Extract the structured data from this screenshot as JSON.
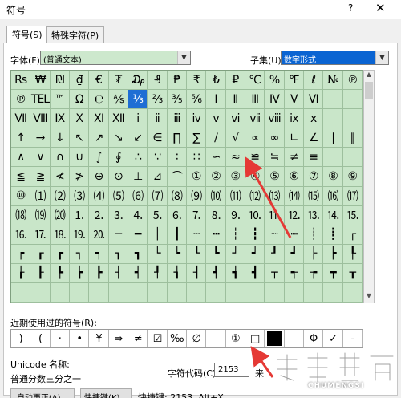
{
  "window": {
    "title": "符号",
    "help": "?",
    "close": "✕"
  },
  "tabs": [
    "符号(S)",
    "特殊字符(P)"
  ],
  "font": {
    "label": "字体(F):",
    "value": "(普通文本)"
  },
  "subset": {
    "label": "子集(U):",
    "value": "数字形式"
  },
  "grid": [
    [
      "Rs",
      "₩",
      "₪",
      "₫",
      "€",
      "₮",
      "₯",
      "₰",
      "₱",
      "₹",
      "₺",
      "₽",
      "℃",
      "%",
      "℉",
      "ℓ",
      "№",
      "℗"
    ],
    [
      "℗",
      "TEL",
      "™",
      "Ω",
      "℮",
      "⅍",
      "⅓",
      "⅔",
      "⅗",
      "⅚",
      "Ⅰ",
      "Ⅱ",
      "Ⅲ",
      "Ⅳ",
      "Ⅴ",
      "Ⅵ",
      "",
      ""
    ],
    [
      "Ⅶ",
      "Ⅷ",
      "Ⅸ",
      "Ⅹ",
      "Ⅺ",
      "Ⅻ",
      "ⅰ",
      "ⅱ",
      "ⅲ",
      "ⅳ",
      "ⅴ",
      "ⅵ",
      "ⅶ",
      "ⅷ",
      "ⅸ",
      "ⅹ",
      "",
      ""
    ],
    [
      "↑",
      "→",
      "↓",
      "↖",
      "↗",
      "↘",
      "↙",
      "∈",
      "∏",
      "∑",
      "/",
      "√",
      "∝",
      "∞",
      "∟",
      "∠",
      "∣",
      "∥"
    ],
    [
      "∧",
      "∨",
      "∩",
      "∪",
      "∫",
      "∮",
      "∴",
      "∵",
      "∶",
      "∷",
      "∽",
      "≈",
      "≌",
      "≒",
      "≠",
      "≡",
      "",
      ""
    ],
    [
      "≦",
      "≧",
      "≮",
      "≯",
      "⊕",
      "⊙",
      "⊥",
      "⊿",
      "⌒",
      "①",
      "②",
      "③",
      "④",
      "⑤",
      "⑥",
      "⑦",
      "⑧",
      "⑨"
    ],
    [
      "⑩",
      "⑴",
      "⑵",
      "⑶",
      "⑷",
      "⑸",
      "⑹",
      "⑺",
      "⑻",
      "⑼",
      "⑽",
      "⑾",
      "⑿",
      "⒀",
      "⒁",
      "⒂",
      "⒃",
      "⒄"
    ],
    [
      "⒅",
      "⒆",
      "⒇",
      "⒈",
      "⒉",
      "⒊",
      "⒋",
      "⒌",
      "⒍",
      "⒎",
      "⒏",
      "⒐",
      "⒑",
      "⒒",
      "⒓",
      "⒔",
      "⒕",
      "⒖"
    ],
    [
      "⒗",
      "⒘",
      "⒙",
      "⒚",
      "⒛",
      "─",
      "━",
      "│",
      "┃",
      "┄",
      "┅",
      "┆",
      "┇",
      "┈",
      "┉",
      "┊",
      "┋",
      "┌"
    ],
    [
      "┍",
      "┎",
      "┏",
      "┐",
      "┑",
      "┒",
      "┓",
      "└",
      "┕",
      "┖",
      "┗",
      "┘",
      "┙",
      "┚",
      "┛",
      "├",
      "┝",
      "┞"
    ],
    [
      "┟",
      "┠",
      "┡",
      "┢",
      "┣",
      "┤",
      "┥",
      "┦",
      "┧",
      "┨",
      "┩",
      "┪",
      "┫",
      "┬",
      "┭",
      "┮",
      "┯",
      "┰"
    ],
    [
      "",
      "",
      "",
      "",
      "",
      "",
      "",
      "",
      "",
      "",
      "",
      "",
      "",
      "",
      "",
      "",
      "",
      ""
    ]
  ],
  "recent": {
    "label": "近期使用过的符号(R):",
    "items": [
      ")",
      "(",
      "·",
      "•",
      "¥",
      "⇛",
      "≠",
      "☑",
      "‰",
      "∅",
      "—",
      "①",
      "□",
      "■",
      "—",
      "Φ",
      "✓",
      "-"
    ]
  },
  "unicode": {
    "label": "Unicode 名称:",
    "value": "普通分数三分之一"
  },
  "charcode": {
    "label": "字符代码(C):",
    "value": "2153",
    "suffix": "来"
  },
  "buttons": {
    "autocorrect": "自动更正(A)...",
    "shortcut_key": "快捷键(K)...",
    "shortcut_info": "快捷键: 2153, Alt+X"
  },
  "watermark": {
    "text": "CHUMENGSI"
  },
  "colors": {
    "grid_bg": "#c9e6c9",
    "selected": "#1f6ed4",
    "arrow": "#e53935"
  },
  "selected_symbol": "⅓"
}
